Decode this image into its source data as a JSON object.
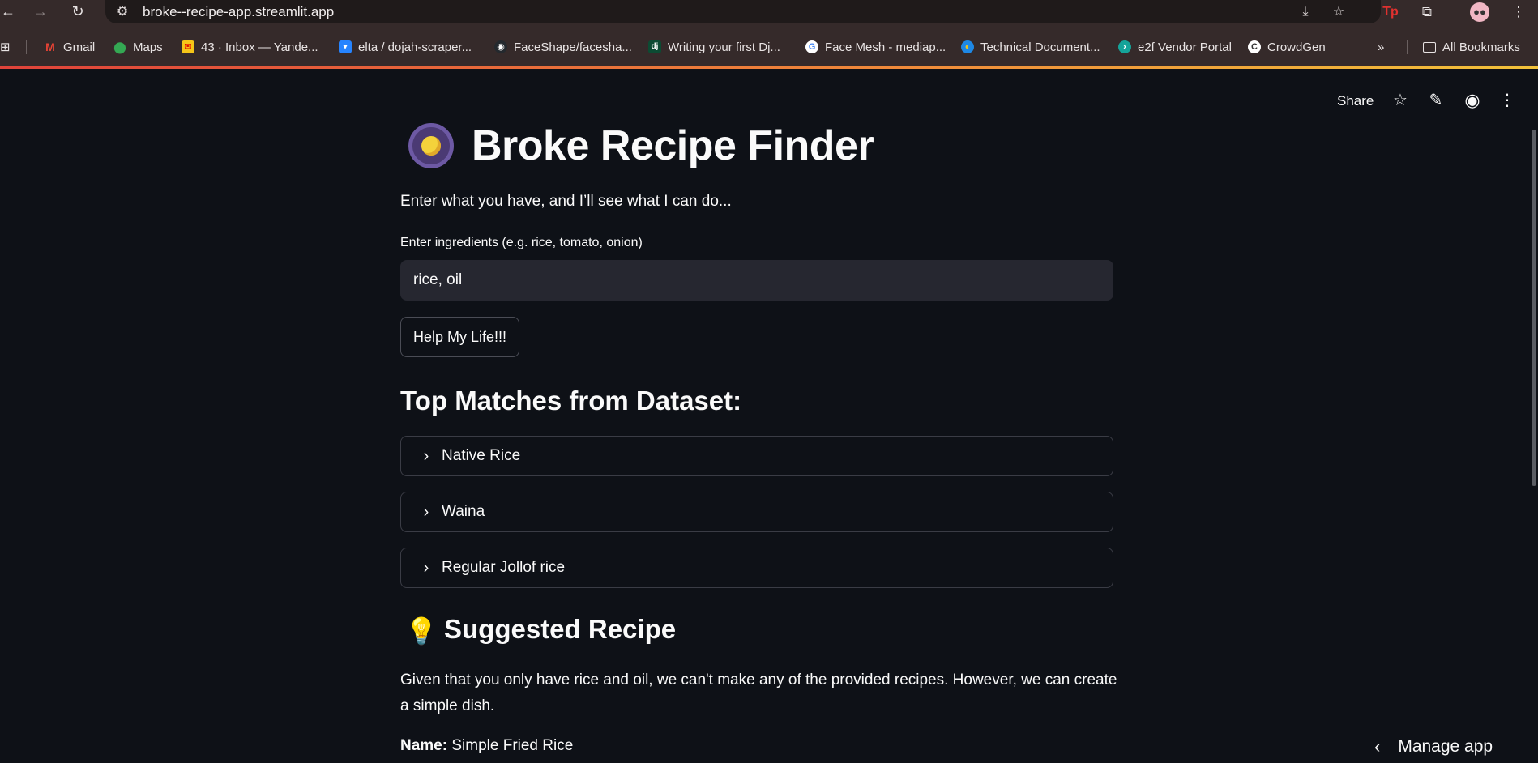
{
  "browser": {
    "url": "broke--recipe-app.streamlit.app",
    "bookmarks": [
      {
        "label": "Gmail",
        "icon": "gmail-icon",
        "color": "#ea4335"
      },
      {
        "label": "Maps",
        "icon": "maps-icon",
        "color": "#34a853"
      },
      {
        "label": "43 · Inbox — Yande...",
        "icon": "yandex-mail-icon",
        "color": "#f5c518"
      },
      {
        "label": "elta / dojah-scraper...",
        "icon": "bitbucket-icon",
        "color": "#2684ff"
      },
      {
        "label": "FaceShape/facesha...",
        "icon": "github-icon",
        "color": "#24292e"
      },
      {
        "label": "Writing your first Dj...",
        "icon": "django-icon",
        "color": "#0c4b33"
      },
      {
        "label": "Face Mesh - mediap...",
        "icon": "google-icon",
        "color": "#4285f4"
      },
      {
        "label": "Technical Document...",
        "icon": "document-icon",
        "color": "#1e88e5"
      },
      {
        "label": "e2f Vendor Portal",
        "icon": "e2f-icon",
        "color": "#15a399"
      },
      {
        "label": "CrowdGen",
        "icon": "crowdgen-icon",
        "color": "#ffffff"
      }
    ],
    "all_bookmarks_label": "All Bookmarks"
  },
  "toolbar": {
    "share_label": "Share"
  },
  "app": {
    "title": "Broke Recipe Finder",
    "subtitle": "Enter what you have, and I’ll see what I can do...",
    "input_label": "Enter ingredients (e.g. rice, tomato, onion)",
    "input_value": "rice, oil",
    "button_label": "Help My Life!!!",
    "matches_heading": "Top Matches from Dataset:",
    "matches": [
      "Native Rice",
      "Waina",
      "Regular Jollof rice"
    ],
    "suggested_heading": "Suggested Recipe",
    "suggestion_text": "Given that you only have rice and oil, we can't make any of the provided recipes. However, we can create a simple dish.",
    "name_label": "Name:",
    "name_value": "Simple Fried Rice",
    "manage_label": "Manage app"
  },
  "colors": {
    "app_bg": "#0e1117",
    "input_bg": "#262730",
    "chrome_bg": "#352a2a",
    "accent_gradient": "#e2553b"
  }
}
